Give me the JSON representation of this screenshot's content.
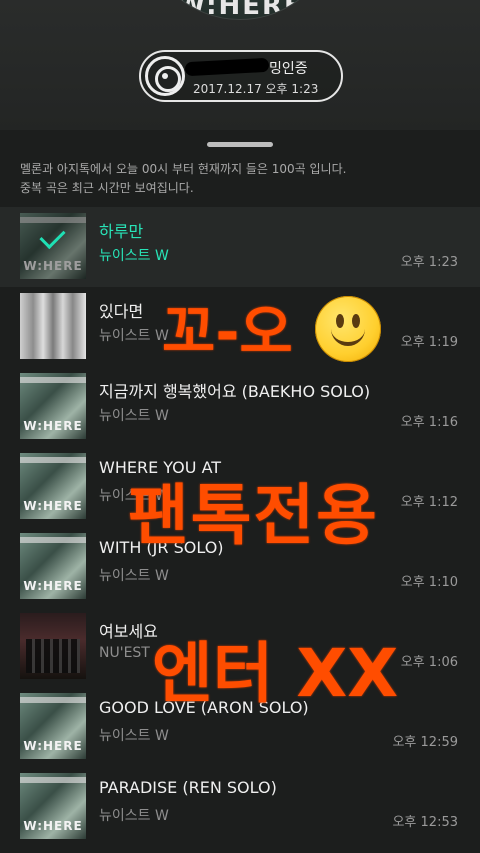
{
  "header": {
    "album_peek_text": "W:HERE",
    "cert_label": "밍인증",
    "cert_date": "2017.12.17 오후 1:23"
  },
  "notice": {
    "line1": "멜론과 아지톡에서 오늘 00시 부터 현재까지 들은 100곡 입니다.",
    "line2": "중복 곡은 최근 시간만 보여집니다."
  },
  "songs": [
    {
      "title": "하루만",
      "artist": "뉴이스트 W",
      "time": "오후 1:23",
      "thumb": "where",
      "active": true
    },
    {
      "title": "있다면",
      "artist": "뉴이스트 W",
      "time": "오후 1:19",
      "thumb": "bw"
    },
    {
      "title": "지금까지 행복했어요 (BAEKHO SOLO)",
      "artist": "뉴이스트 W",
      "time": "오후 1:16",
      "thumb": "where"
    },
    {
      "title": "WHERE YOU AT",
      "artist": "뉴이스트 W",
      "time": "오후 1:12",
      "thumb": "where"
    },
    {
      "title": "WITH (JR SOLO)",
      "artist": "뉴이스트 W",
      "time": "오후 1:10",
      "thumb": "where"
    },
    {
      "title": "여보세요",
      "artist": "NU'EST",
      "time": "오후 1:06",
      "thumb": "night"
    },
    {
      "title": "GOOD LOVE (ARON SOLO)",
      "artist": "뉴이스트 W",
      "time": "오후 12:59",
      "thumb": "where"
    },
    {
      "title": "PARADISE (REN SOLO)",
      "artist": "뉴이스트 W",
      "time": "오후 12:53",
      "thumb": "where"
    }
  ],
  "thumb_text": "W:HERE",
  "overlays": {
    "line1": "꼬-오",
    "line2": "팬톡전용",
    "line3": "엔터 XX"
  },
  "colors": {
    "accent": "#28e3b7",
    "overlay": "#ff4d00"
  }
}
